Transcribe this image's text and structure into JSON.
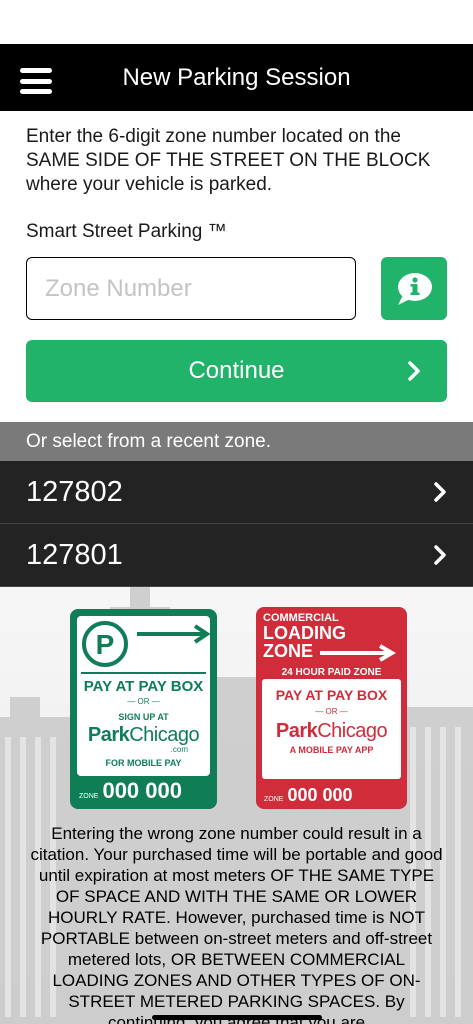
{
  "nav": {
    "title": "New Parking Session"
  },
  "instructions": "Enter the 6-digit zone number located on the SAME SIDE OF THE STREET ON THE BLOCK where your vehicle is parked.",
  "brand_label": "Smart Street Parking ™",
  "zone_input": {
    "placeholder": "Zone Number",
    "value": ""
  },
  "continue_label": "Continue",
  "recent": {
    "header": "Or select from a recent zone.",
    "zones": [
      "127802",
      "127801"
    ]
  },
  "signs": {
    "green": {
      "title": "PAY AT PAY BOX",
      "or": "— OR —",
      "signup": "SIGN UP AT",
      "brand_a": "Park",
      "brand_b": "Chicago",
      "brand_c": ".com",
      "footer": "FOR MOBILE PAY",
      "zone_label": "ZONE",
      "zone_number": "000 000"
    },
    "red": {
      "line1": "COMMERCIAL",
      "line2": "LOADING",
      "line3": "ZONE",
      "subtitle": "24 HOUR PAID ZONE",
      "title": "PAY AT PAY BOX",
      "or": "— OR —",
      "brand_a": "Park",
      "brand_b": "Chicago",
      "footer": "A MOBILE PAY APP",
      "zone_label": "ZONE",
      "zone_number": "000 000"
    }
  },
  "warning": "Entering the wrong zone number could result in a citation. Your purchased time will be portable and good until expiration at most meters OF THE SAME TYPE OF SPACE AND WITH THE SAME OR LOWER HOURLY RATE. However, purchased time is NOT PORTABLE between on-street meters and off-street metered lots, OR BETWEEN COMMERCIAL LOADING ZONES AND OTHER TYPES OF ON-STREET METERED PARKING SPACES. By continuing, you agree that you are"
}
